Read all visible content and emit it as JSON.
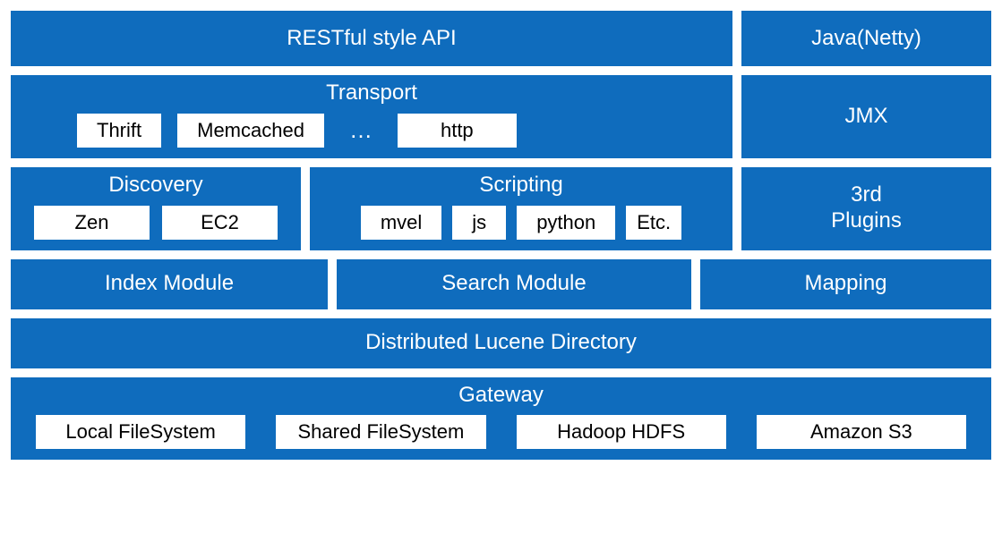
{
  "row1": {
    "rest": "RESTful style API",
    "java": "Java(Netty)"
  },
  "row2": {
    "transport": {
      "title": "Transport",
      "items": [
        "Thrift",
        "Memcached",
        "http"
      ],
      "more": "…"
    },
    "jmx": "JMX"
  },
  "row3": {
    "discovery": {
      "title": "Discovery",
      "items": [
        "Zen",
        "EC2"
      ]
    },
    "scripting": {
      "title": "Scripting",
      "items": [
        "mvel",
        "js",
        "python",
        "Etc."
      ]
    },
    "plugins": "3rd\nPlugins"
  },
  "row4": {
    "index": "Index Module",
    "search": "Search Module",
    "mapping": "Mapping"
  },
  "row5": {
    "lucene": "Distributed Lucene Directory"
  },
  "row6": {
    "gateway": {
      "title": "Gateway",
      "items": [
        "Local FileSystem",
        "Shared FileSystem",
        "Hadoop HDFS",
        "Amazon S3"
      ]
    }
  }
}
